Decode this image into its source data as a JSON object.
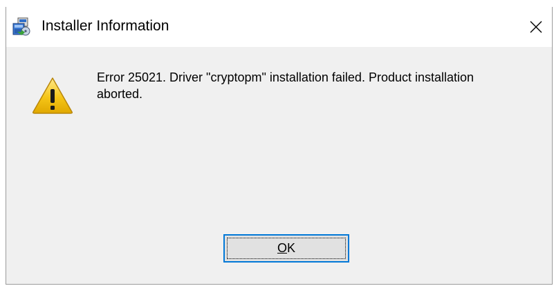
{
  "window": {
    "title": "Installer Information",
    "title_icon": "installer-package-icon",
    "close_icon": "close-icon"
  },
  "body": {
    "icon": "warning-icon",
    "message": "Error 25021. Driver \"cryptopm\" installation failed. Product installation aborted."
  },
  "buttons": {
    "ok_accel": "O",
    "ok_rest": "K"
  },
  "colors": {
    "focus_border": "#0078d7",
    "dialog_bg": "#f0f0f0",
    "button_bg": "#e1e1e1",
    "warning_fill": "#f5c518"
  }
}
